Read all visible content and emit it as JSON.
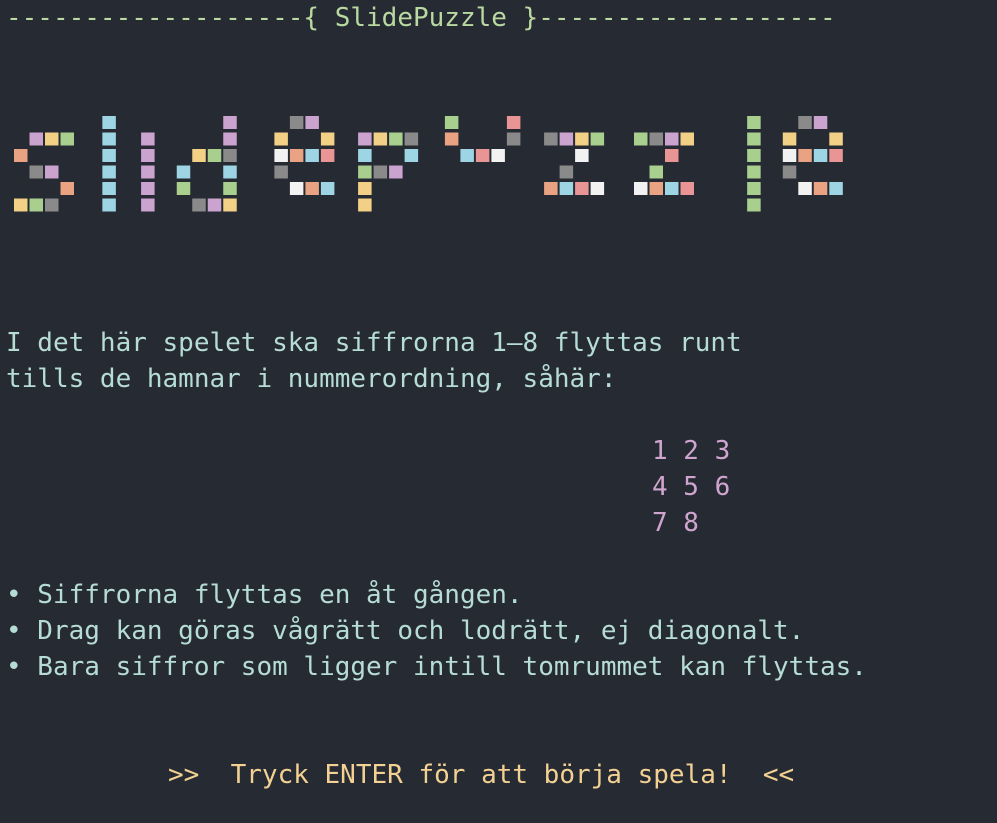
{
  "title_bar": "-------------------{ SlidePuzzle }-------------------",
  "logo": {
    "text": "slidepuzzle",
    "palette": [
      "#a8cf8e",
      "#e99595",
      "#f2d085",
      "#9ed5e4",
      "#cba3cf",
      "#e9a382",
      "#8a8a8a",
      "#f2f2f2"
    ]
  },
  "intro": {
    "line1": "I det här spelet ska siffrorna 1–8 flyttas runt",
    "line2": "tills de hamnar i nummerordning, såhär:"
  },
  "solved_grid": {
    "row1": "1 2 3",
    "row2": "4 5 6",
    "row3": "7 8"
  },
  "rules": {
    "rule1": "• Siffrorna flyttas en åt gången.",
    "rule2": "• Drag kan göras vågrätt och lodrätt, ej diagonalt.",
    "rule3": "• Bara siffror som ligger intill tomrummet kan flyttas."
  },
  "prompt": ">>  Tryck ENTER för att börja spela!  <<"
}
